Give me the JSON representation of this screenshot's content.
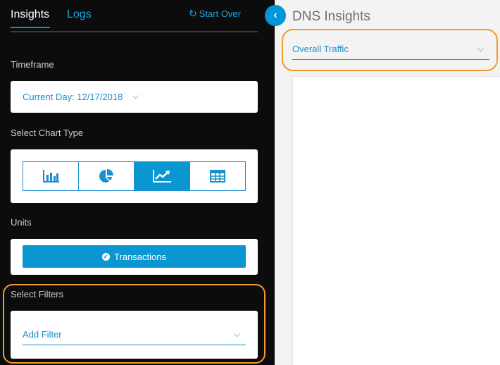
{
  "tabs": [
    {
      "label": "Insights",
      "active": true
    },
    {
      "label": "Logs",
      "active": false
    }
  ],
  "start_over": {
    "label": "Start Over",
    "icon": "refresh-icon"
  },
  "timeframe": {
    "label": "Timeframe",
    "value": "Current Day: 12/17/2018"
  },
  "chart_type": {
    "label": "Select Chart Type",
    "options": [
      {
        "icon": "bar-chart-icon",
        "active": false
      },
      {
        "icon": "pie-chart-icon",
        "active": false
      },
      {
        "icon": "line-chart-icon",
        "active": true
      },
      {
        "icon": "table-icon",
        "active": false
      }
    ]
  },
  "units": {
    "label": "Units",
    "button_label": "Transactions",
    "icon": "check-circle-icon"
  },
  "filters": {
    "label": "Select Filters",
    "placeholder": "Add Filter"
  },
  "main": {
    "title": "DNS Insights",
    "selector_value": "Overall Traffic"
  },
  "colors": {
    "accent": "#0096d6",
    "highlight": "#f29a2e",
    "panel": "#0c0c0c"
  }
}
